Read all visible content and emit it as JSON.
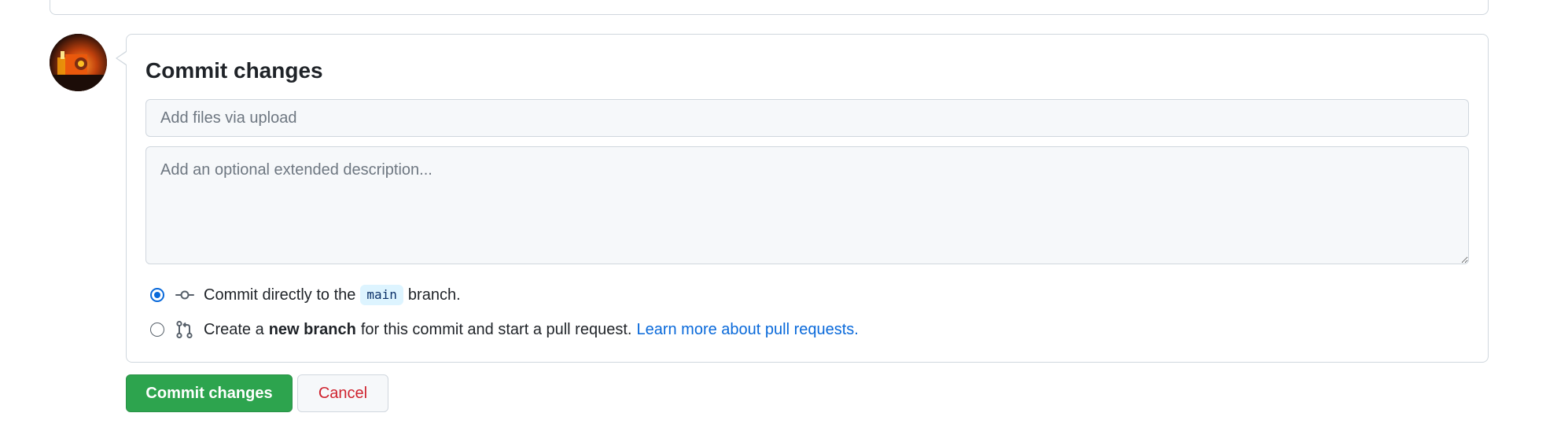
{
  "commit_form": {
    "title": "Commit changes",
    "summary_placeholder": "Add files via upload",
    "summary_value": "",
    "description_placeholder": "Add an optional extended description...",
    "description_value": "",
    "option_direct": {
      "selected": true,
      "prefix": "Commit directly to the",
      "branch": "main",
      "suffix": "branch.",
      "icon": "git-commit-icon"
    },
    "option_new_branch": {
      "selected": false,
      "prefix": "Create a",
      "bold": "new branch",
      "suffix": "for this commit and start a pull request.",
      "link": "Learn more about pull requests.",
      "icon": "git-pull-request-icon"
    }
  },
  "actions": {
    "commit_label": "Commit changes",
    "cancel_label": "Cancel"
  },
  "colors": {
    "primary_button": "#2da44e",
    "cancel_text": "#cf222e",
    "link": "#0969da",
    "radio_accent": "#0969da"
  }
}
